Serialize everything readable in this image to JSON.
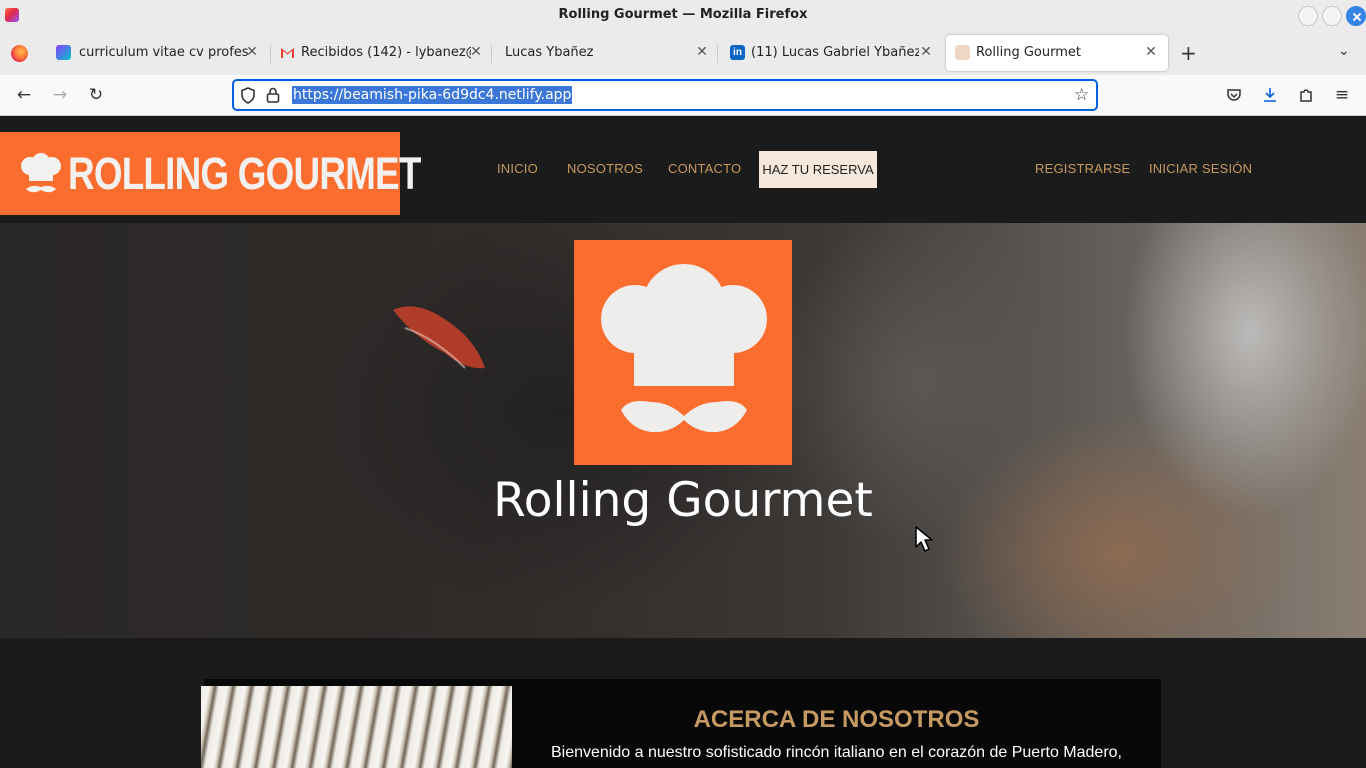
{
  "window": {
    "title": "Rolling Gourmet — Mozilla Firefox"
  },
  "tabs": [
    {
      "label": "curriculum vitae cv profesio",
      "favicon": "canva-icon"
    },
    {
      "label": "Recibidos (142) - lybanez@e",
      "favicon": "gmail-icon"
    },
    {
      "label": "Lucas Ybañez",
      "favicon": "none"
    },
    {
      "label": "(11) Lucas Gabriel Ybañez | L",
      "favicon": "linkedin-icon"
    },
    {
      "label": "Rolling Gourmet",
      "favicon": "chef-hat-icon",
      "active": true
    }
  ],
  "addressbar": {
    "url": "https://beamish-pika-6d9dc4.netlify.app"
  },
  "site": {
    "brand": "ROLLING GOURMET",
    "menu": {
      "inicio": "INICIO",
      "nosotros": "NOSOTROS",
      "contacto": "CONTACTO",
      "reserva": "HAZ TU RESERVA"
    },
    "auth": {
      "register": "REGISTRARSE",
      "login": "INICIAR SESIÓN"
    },
    "hero": {
      "title": "Rolling Gourmet"
    },
    "about": {
      "heading": "ACERCA DE NOSOTROS",
      "text": "Bienvenido a nuestro sofisticado rincón italiano en el corazón de Puerto Madero,"
    }
  },
  "colors": {
    "brand_orange": "#fb6d2f",
    "gold": "#c59a62",
    "dark": "#1b1b1b",
    "url_selection": "#3a77d8"
  }
}
